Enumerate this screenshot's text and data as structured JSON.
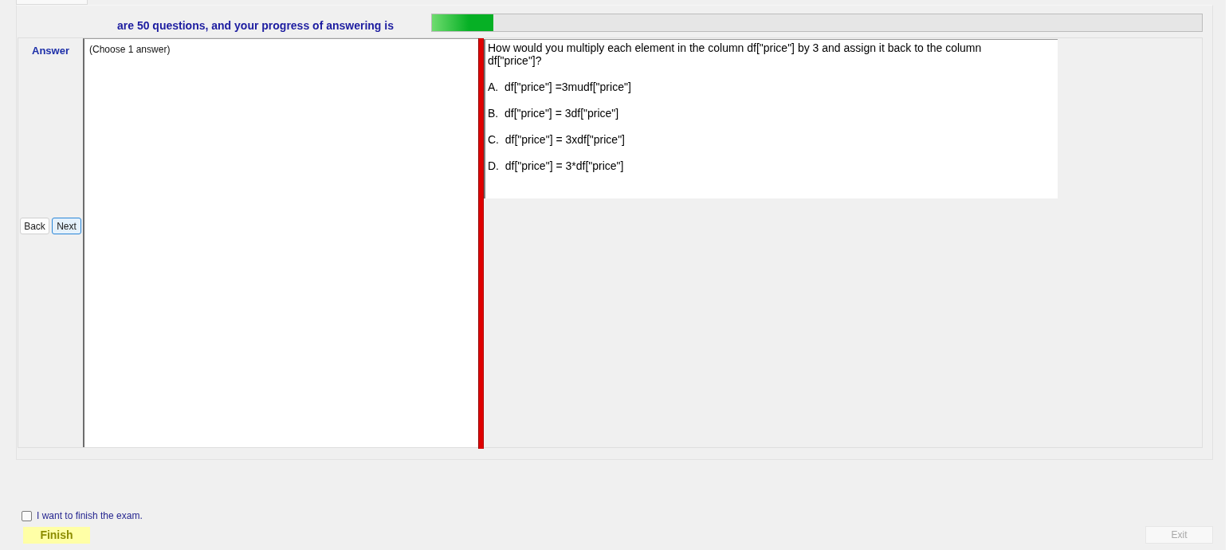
{
  "header": {
    "text": "are 50 questions, and your progress of answering is",
    "progress": {
      "level": 0.08
    }
  },
  "answer_panel": {
    "label": "Answer",
    "instruction": "(Choose 1 answer)"
  },
  "navigation": [
    {
      "label": "Back",
      "kind": "plain"
    },
    {
      "label": "Next",
      "kind": "default"
    }
  ],
  "question": {
    "text": "How would you multiply each element in the column df[\"price\"] by 3 and assign it back to the column df[\"price\"]?",
    "options": [
      "A.  df[\"price\"] =3mudf[\"price\"]",
      "B.  df[\"price\"] = 3df[\"price\"]",
      "C.  df[\"price\"] = 3xdf[\"price\"]",
      "D.  df[\"price\"] = 3*df[\"price\"]"
    ]
  },
  "finish_confirm": {
    "label": "I want to finish the exam.",
    "checked": false
  },
  "finish_button": {
    "label": "Finish",
    "disabled": false
  },
  "exit_button": {
    "label": "Exit",
    "disabled": true
  }
}
